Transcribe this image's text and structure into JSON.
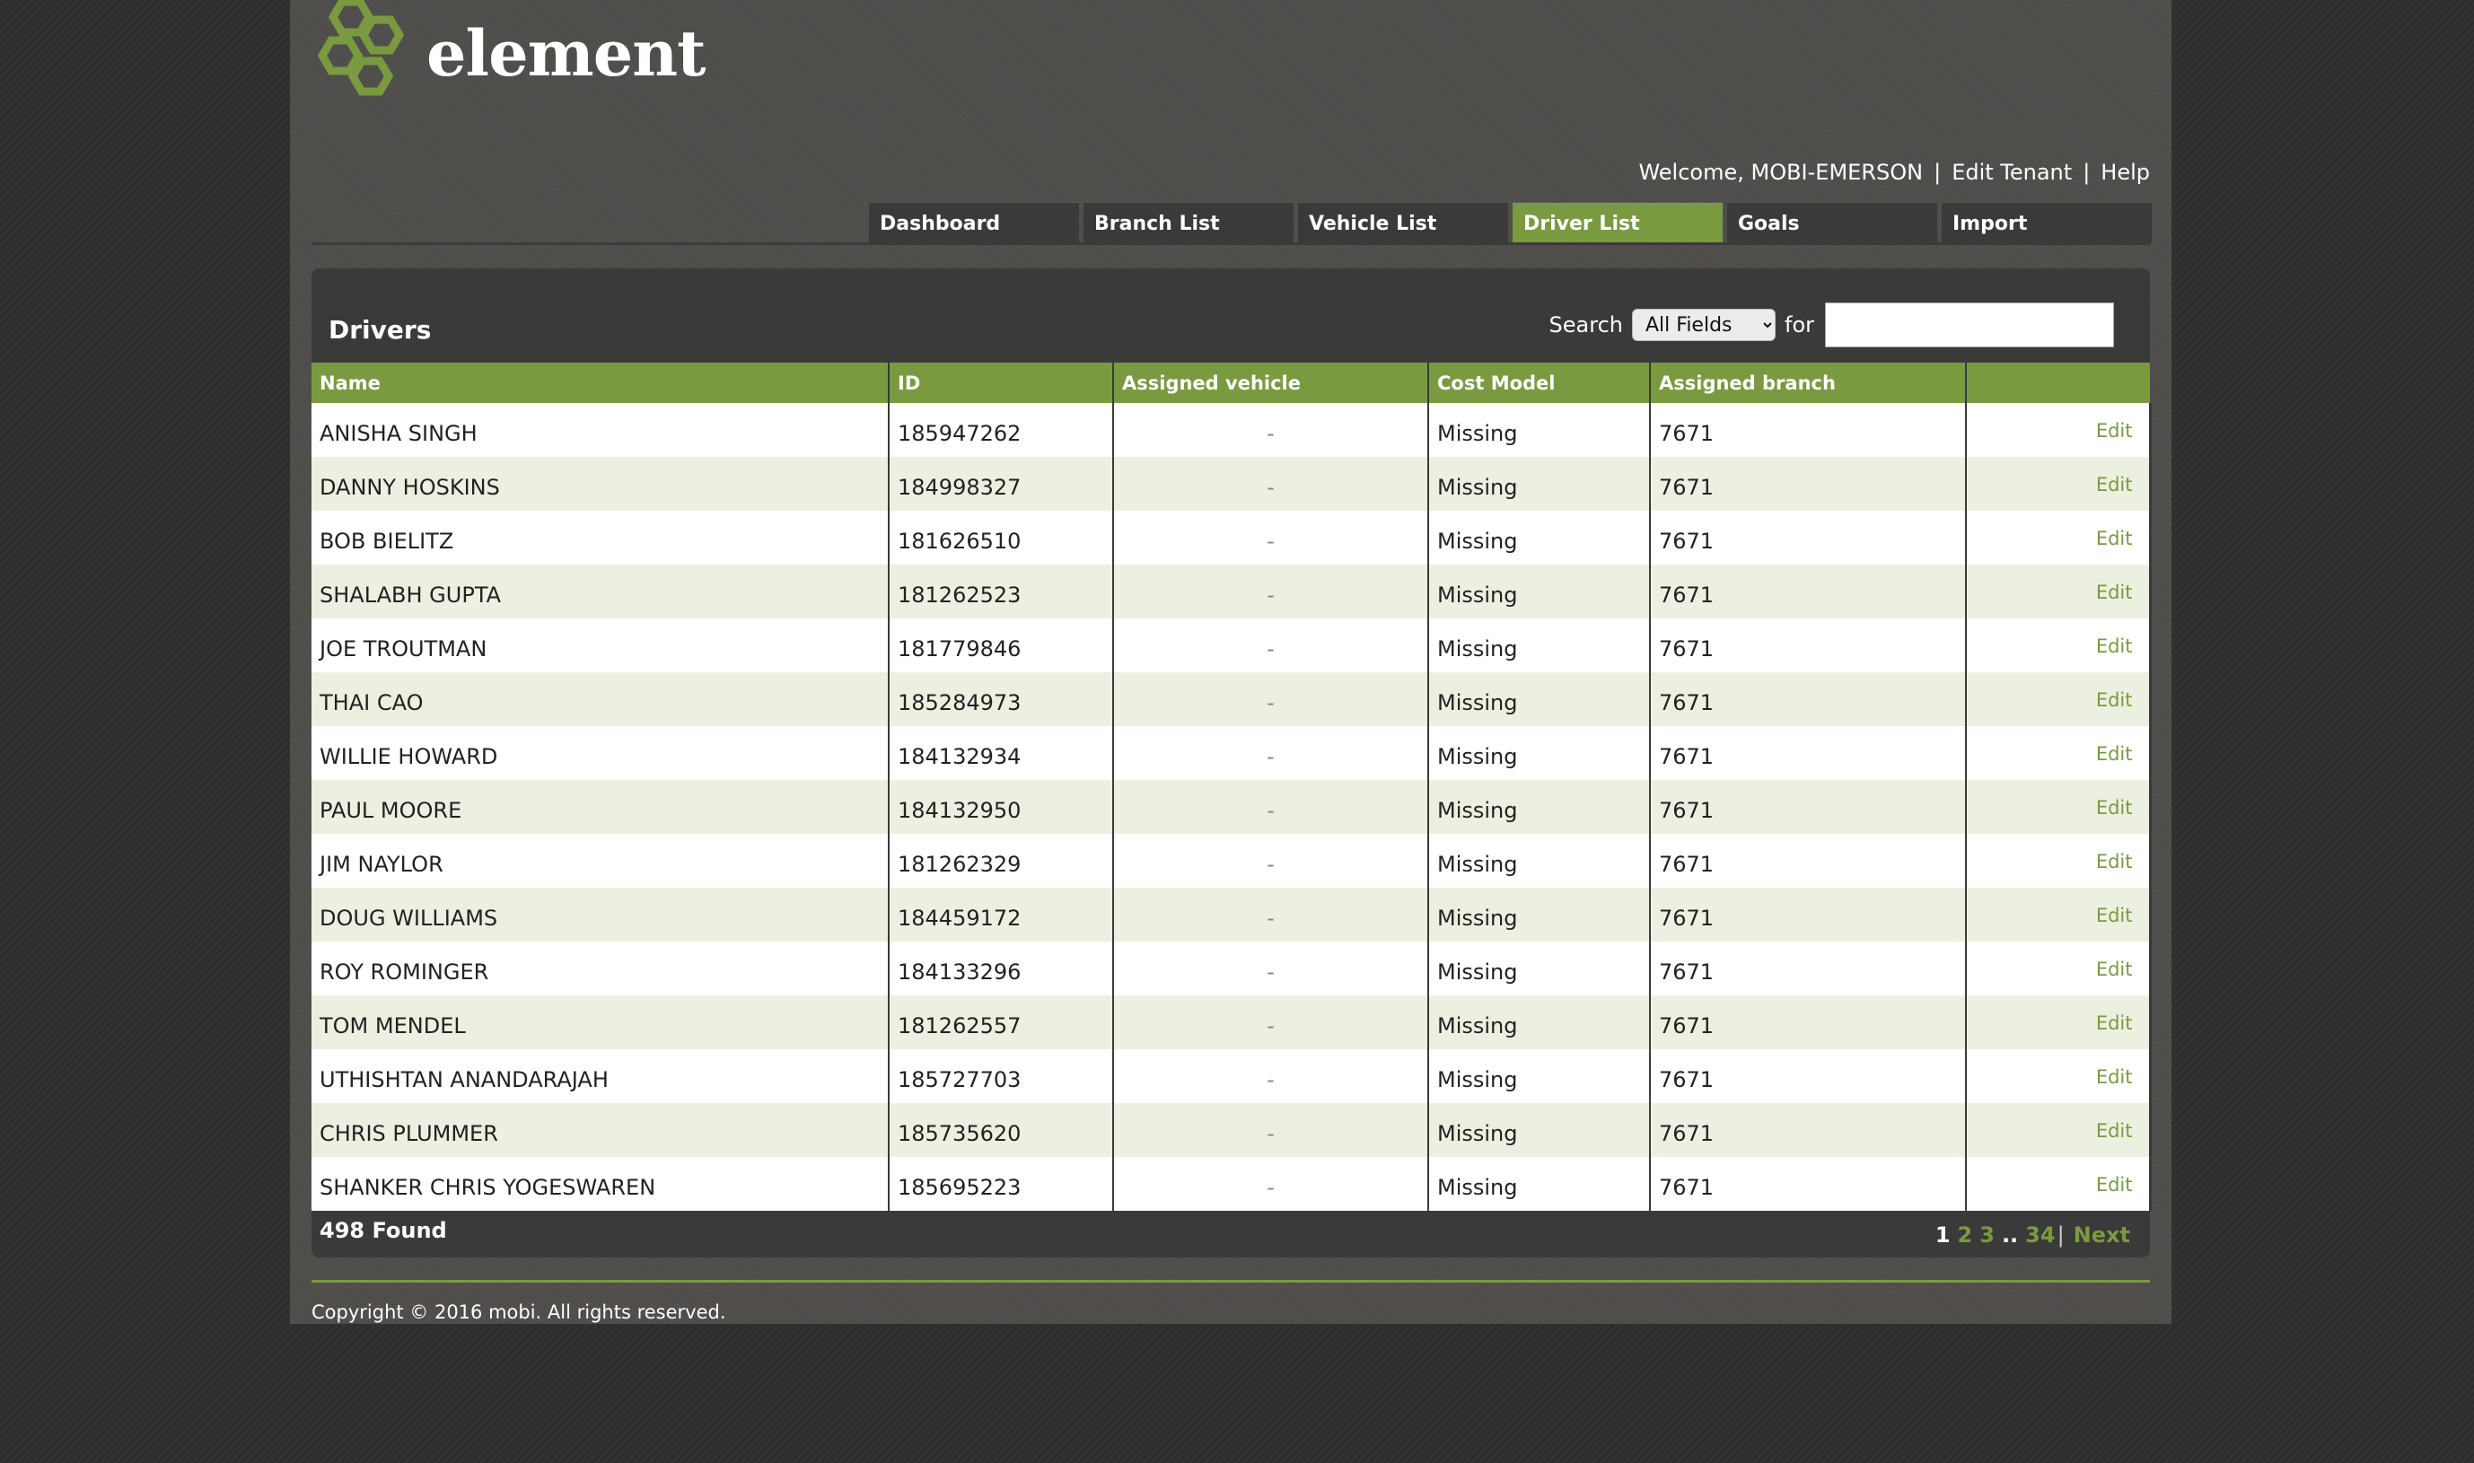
{
  "logo": {
    "text": "element",
    "icon": "hexagon-cluster-logo"
  },
  "userbar": {
    "welcome": "Welcome, MOBI-EMERSON",
    "sep": "|",
    "edit_tenant": "Edit Tenant",
    "help": "Help"
  },
  "nav": {
    "tabs": [
      {
        "label": "Dashboard",
        "active": false
      },
      {
        "label": "Branch List",
        "active": false
      },
      {
        "label": "Vehicle List",
        "active": false
      },
      {
        "label": "Driver List",
        "active": true
      },
      {
        "label": "Goals",
        "active": false
      },
      {
        "label": "Import",
        "active": false
      }
    ]
  },
  "panel": {
    "title": "Drivers",
    "search_label": "Search",
    "search_field": "All Fields",
    "for_label": "for",
    "search_value": ""
  },
  "table": {
    "headers": [
      "Name",
      "ID",
      "Assigned vehicle",
      "Cost Model",
      "Assigned branch",
      ""
    ],
    "rows": [
      {
        "name": "ANISHA SINGH",
        "id": "185947262",
        "vehicle": "-",
        "cost": "Missing",
        "branch": "7671",
        "action": "Edit"
      },
      {
        "name": "DANNY HOSKINS",
        "id": "184998327",
        "vehicle": "-",
        "cost": "Missing",
        "branch": "7671",
        "action": "Edit"
      },
      {
        "name": "BOB BIELITZ",
        "id": "181626510",
        "vehicle": "-",
        "cost": "Missing",
        "branch": "7671",
        "action": "Edit"
      },
      {
        "name": "SHALABH GUPTA",
        "id": "181262523",
        "vehicle": "-",
        "cost": "Missing",
        "branch": "7671",
        "action": "Edit"
      },
      {
        "name": "JOE TROUTMAN",
        "id": "181779846",
        "vehicle": "-",
        "cost": "Missing",
        "branch": "7671",
        "action": "Edit"
      },
      {
        "name": "THAI CAO",
        "id": "185284973",
        "vehicle": "-",
        "cost": "Missing",
        "branch": "7671",
        "action": "Edit"
      },
      {
        "name": "WILLIE HOWARD",
        "id": "184132934",
        "vehicle": "-",
        "cost": "Missing",
        "branch": "7671",
        "action": "Edit"
      },
      {
        "name": "PAUL MOORE",
        "id": "184132950",
        "vehicle": "-",
        "cost": "Missing",
        "branch": "7671",
        "action": "Edit"
      },
      {
        "name": "JIM NAYLOR",
        "id": "181262329",
        "vehicle": "-",
        "cost": "Missing",
        "branch": "7671",
        "action": "Edit"
      },
      {
        "name": "DOUG WILLIAMS",
        "id": "184459172",
        "vehicle": "-",
        "cost": "Missing",
        "branch": "7671",
        "action": "Edit"
      },
      {
        "name": "ROY ROMINGER",
        "id": "184133296",
        "vehicle": "-",
        "cost": "Missing",
        "branch": "7671",
        "action": "Edit"
      },
      {
        "name": "TOM MENDEL",
        "id": "181262557",
        "vehicle": "-",
        "cost": "Missing",
        "branch": "7671",
        "action": "Edit"
      },
      {
        "name": "UTHISHTAN ANANDARAJAH",
        "id": "185727703",
        "vehicle": "-",
        "cost": "Missing",
        "branch": "7671",
        "action": "Edit"
      },
      {
        "name": "CHRIS PLUMMER",
        "id": "185735620",
        "vehicle": "-",
        "cost": "Missing",
        "branch": "7671",
        "action": "Edit"
      },
      {
        "name": "SHANKER CHRIS YOGESWAREN",
        "id": "185695223",
        "vehicle": "-",
        "cost": "Missing",
        "branch": "7671",
        "action": "Edit"
      }
    ]
  },
  "summary": {
    "found": "498 Found"
  },
  "pager": {
    "current": "1",
    "pages": [
      "2",
      "3"
    ],
    "ellipsis": "..",
    "last": "34",
    "sep": "|",
    "next": "Next"
  },
  "footer": {
    "copyright": "Copyright © 2016 mobi. All rights reserved."
  },
  "colors": {
    "accent": "#7a9a40",
    "panel": "#3a3a3a",
    "page": "#4f4e4b",
    "background": "#2e2e31"
  }
}
